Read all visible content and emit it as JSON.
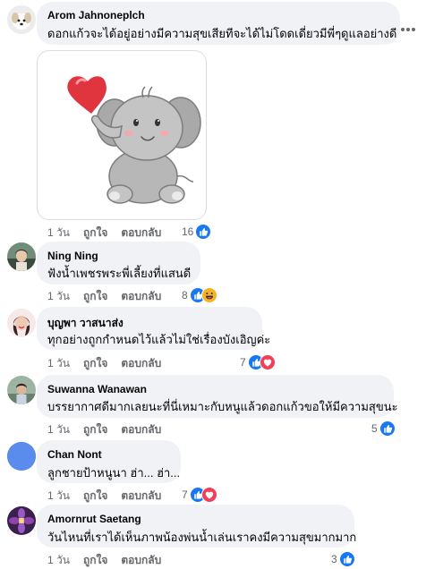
{
  "comments": [
    {
      "author": "Arom Jahnoneplch",
      "text": "ดอกแก้วจะได้อยู่อย่างมีความสุขเสียทีจะได้ไม่โดดเดี่ยวมีพี่ๆดูแลอย่างดี",
      "time": "1 วัน",
      "like_label": "ถูกใจ",
      "reply_label": "ตอบกลับ",
      "reaction_count": "16",
      "reactions": [
        "like"
      ]
    },
    {
      "author": "Ning Ning",
      "text": "ฟังน้ำเพชรพระพี่เลี้ยงที่แสนดี",
      "time": "1 วัน",
      "like_label": "ถูกใจ",
      "reply_label": "ตอบกลับ",
      "reaction_count": "8",
      "reactions": [
        "like",
        "haha"
      ]
    },
    {
      "author": "บุญพา วาสนาส่ง",
      "text": "ทุกอย่างถูกกำหนดไว้แล้วไม่ใช่เรื่องบังเอิญค่ะ",
      "time": "1 วัน",
      "like_label": "ถูกใจ",
      "reply_label": "ตอบกลับ",
      "reaction_count": "7",
      "reactions": [
        "like",
        "love"
      ]
    },
    {
      "author": "Suwanna Wanawan",
      "text": "บรรยากาศดีมากเลยนะที่นี่เหมาะกับหนูแล้วดอกแก้วขอให้มีความสุขนะ",
      "time": "1 วัน",
      "like_label": "ถูกใจ",
      "reply_label": "ตอบกลับ",
      "reaction_count": "5",
      "reactions": [
        "like"
      ]
    },
    {
      "author": "Chan Nont",
      "text": "ลูกชายป้าหนูนา ฮ่า... ฮ่า...",
      "time": "1 วัน",
      "like_label": "ถูกใจ",
      "reply_label": "ตอบกลับ",
      "reaction_count": "7",
      "reactions": [
        "like",
        "love"
      ]
    },
    {
      "author": "Amornrut Saetang",
      "text": "วันไหนที่เราได้เห็นภาพน้องพ่นน้ำเล่นเราคงมีความสุขมากมาก",
      "time": "1 วัน",
      "like_label": "ถูกใจ",
      "reply_label": "ตอบกลับ",
      "reaction_count": "3",
      "reactions": [
        "like"
      ]
    }
  ],
  "more_options_icon": "more-horizontal-icon",
  "colors": {
    "like": "#1877f2",
    "love": "#f33e58",
    "haha": "#f7b125",
    "bubble": "#f0f2f5",
    "meta": "#65676b"
  }
}
